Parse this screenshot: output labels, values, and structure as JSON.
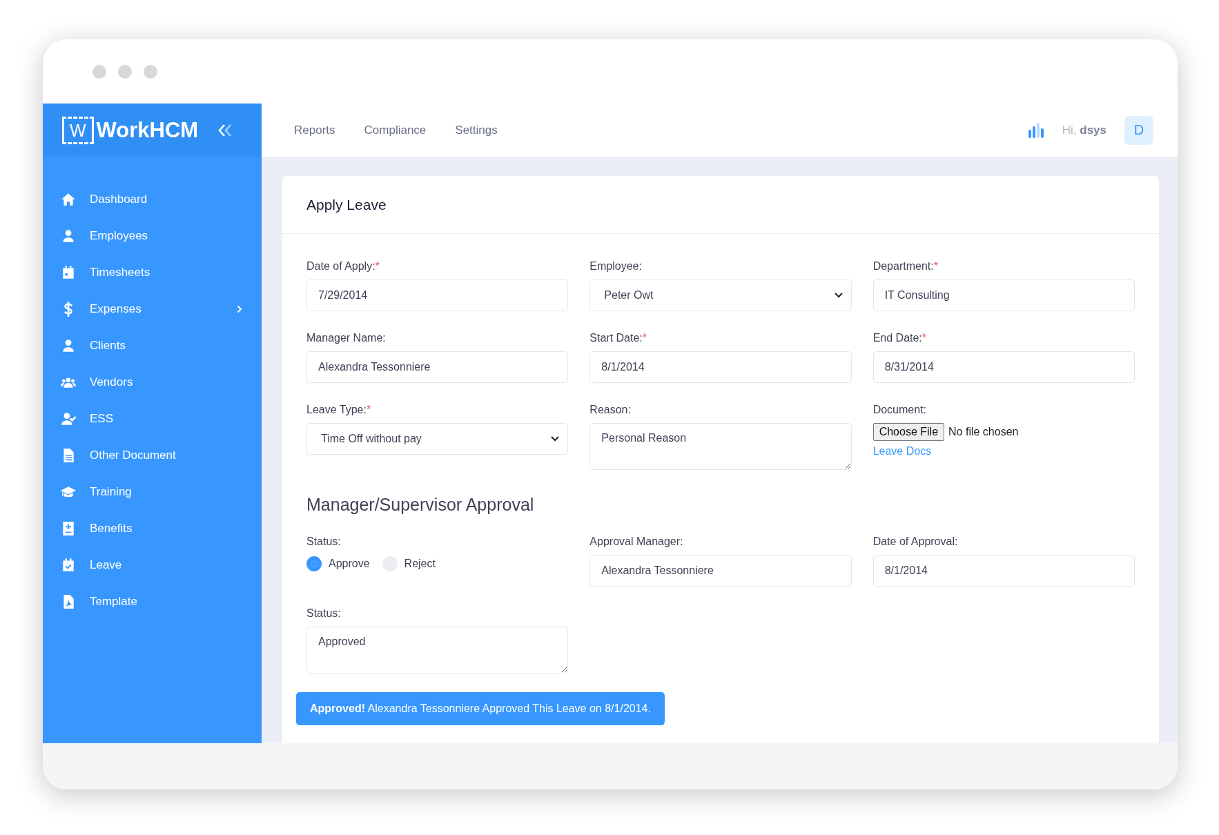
{
  "logo": {
    "mark": "W",
    "name": "WorkHCM"
  },
  "top_nav": [
    {
      "label": "Reports"
    },
    {
      "label": "Compliance"
    },
    {
      "label": "Settings"
    }
  ],
  "user": {
    "greeting": "Hi,",
    "name": "dsys",
    "avatar": "D"
  },
  "sidebar": {
    "items": [
      {
        "label": "Dashboard",
        "submenu": false
      },
      {
        "label": "Employees",
        "submenu": false
      },
      {
        "label": "Timesheets",
        "submenu": false
      },
      {
        "label": "Expenses",
        "submenu": true
      },
      {
        "label": "Clients",
        "submenu": false
      },
      {
        "label": "Vendors",
        "submenu": false
      },
      {
        "label": "ESS",
        "submenu": false
      },
      {
        "label": "Other Document",
        "submenu": false
      },
      {
        "label": "Training",
        "submenu": false
      },
      {
        "label": "Benefits",
        "submenu": false
      },
      {
        "label": "Leave",
        "submenu": false
      },
      {
        "label": "Template",
        "submenu": false
      }
    ]
  },
  "form": {
    "title": "Apply Leave",
    "fields": [
      {
        "kind": "text",
        "label": "Date of Apply:",
        "required_mark": "*",
        "value": "7/29/2014"
      },
      {
        "kind": "select",
        "label": "Employee:",
        "value": "Peter Owt"
      },
      {
        "kind": "text",
        "label": "Department:",
        "required_mark": "*",
        "value": "IT Consulting"
      },
      {
        "kind": "text",
        "label": "Manager Name:",
        "value": "Alexandra Tessonniere"
      },
      {
        "kind": "text",
        "label": "Start Date:",
        "required_mark": "*",
        "value": "8/1/2014"
      },
      {
        "kind": "text",
        "label": "End Date:",
        "required_mark": "*",
        "value": "8/31/2014"
      },
      {
        "kind": "select",
        "label": "Leave Type:",
        "required_mark": "*",
        "value": "Time Off without pay"
      },
      {
        "kind": "textarea",
        "label": "Reason:",
        "value": "Personal Reason"
      },
      {
        "kind": "file",
        "label": "Document:",
        "button": "Choose File",
        "status": "No file chosen",
        "link": "Leave Docs"
      }
    ]
  },
  "approval": {
    "title": "Manager/Supervisor Approval",
    "fields": [
      {
        "kind": "radio",
        "label": "Status:",
        "options": [
          {
            "label": "Approve",
            "selected": true
          },
          {
            "label": "Reject",
            "selected": false
          }
        ]
      },
      {
        "kind": "text",
        "label": "Approval Manager:",
        "value": "Alexandra Tessonniere"
      },
      {
        "kind": "text",
        "label": "Date of Approval:",
        "value": "8/1/2014"
      },
      {
        "kind": "textarea",
        "label": "Status:",
        "value": "Approved"
      }
    ]
  },
  "alert": "**Approved!** Alexandra Tessonniere Approved This Leave on 8/1/2014."
}
